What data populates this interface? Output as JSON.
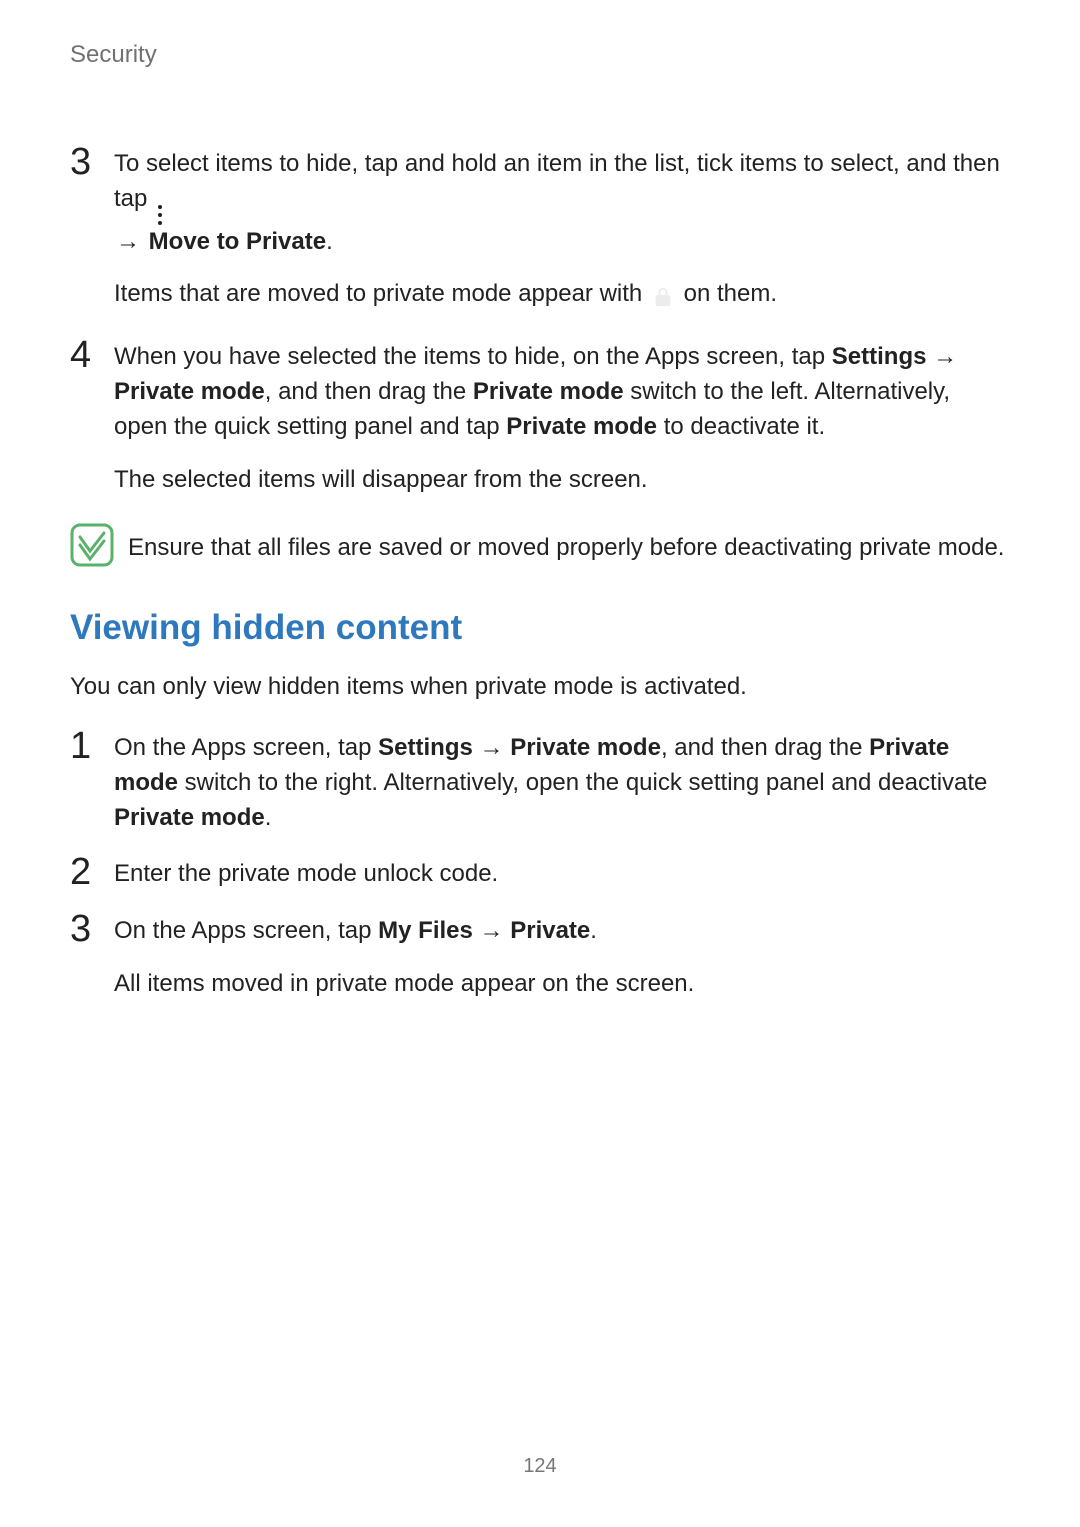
{
  "header": "Security",
  "step3": {
    "num": "3",
    "t1": "To select items to hide, tap and hold an item in the list, tick items to select, and then tap",
    "arrow": "→",
    "bold1": "Move to Private",
    "period": ".",
    "sub_a": "Items that are moved to private mode appear with",
    "sub_b": "on them."
  },
  "step4": {
    "num": "4",
    "t1": "When you have selected the items to hide, on the Apps screen, tap ",
    "b1": "Settings",
    "arrow1": " → ",
    "b2": "Private mode",
    "t2": ", and then drag the ",
    "b3": "Private mode",
    "t3": " switch to the left. Alternatively, open the quick setting panel and tap ",
    "b4": "Private mode",
    "t4": " to deactivate it.",
    "sub": "The selected items will disappear from the screen."
  },
  "note": "Ensure that all files are saved or moved properly before deactivating private mode.",
  "section_heading": "Viewing hidden content",
  "section_intro": "You can only view hidden items when private mode is activated.",
  "v1": {
    "num": "1",
    "t1": "On the Apps screen, tap ",
    "b1": "Settings",
    "arrow1": " → ",
    "b2": "Private mode",
    "t2": ", and then drag the ",
    "b3": "Private mode",
    "t3": " switch to the right. Alternatively, open the quick setting panel and deactivate ",
    "b4": "Private mode",
    "period": "."
  },
  "v2": {
    "num": "2",
    "t": "Enter the private mode unlock code."
  },
  "v3": {
    "num": "3",
    "t1": "On the Apps screen, tap ",
    "b1": "My Files",
    "arrow1": " → ",
    "b2": "Private",
    "period": ".",
    "sub": "All items moved in private mode appear on the screen."
  },
  "page_number": "124"
}
